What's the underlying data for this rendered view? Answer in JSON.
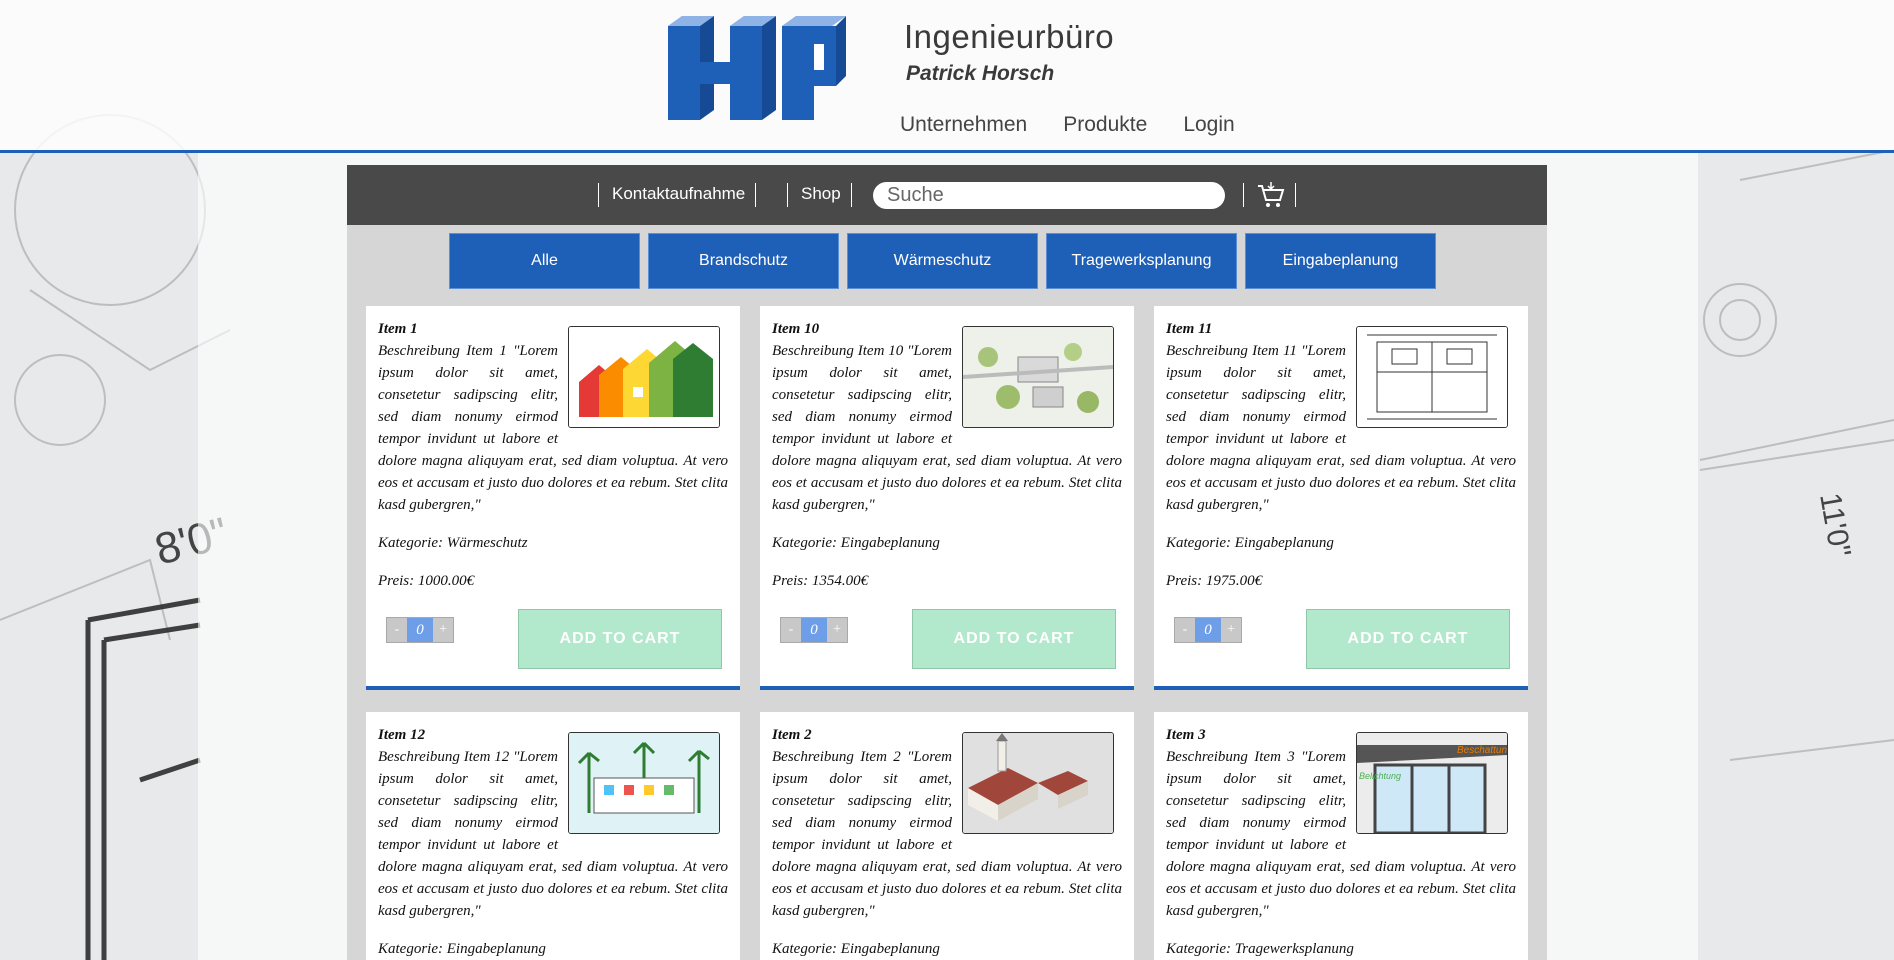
{
  "brand": {
    "title": "Ingenieurbüro",
    "subtitle": "Patrick Horsch",
    "logo_text": "HP"
  },
  "main_nav": [
    "Unternehmen",
    "Produkte",
    "Login"
  ],
  "toolbar": {
    "contact": "Kontaktaufnahme",
    "shop": "Shop",
    "search_placeholder": "Suche",
    "cart_icon": "shopping-cart-icon"
  },
  "filters": [
    "Alle",
    "Brandschutz",
    "Wärmeschutz",
    "Tragewerksplanung",
    "Eingabeplanung"
  ],
  "products": [
    {
      "title": "Item 1",
      "description": "Beschreibung Item 1 \"Lorem ipsum dolor sit amet, consetetur sadipscing elitr, sed diam nonumy eirmod tempor invidunt ut labore et dolore magna aliquyam erat, sed diam voluptua. At vero eos et accusam et justo duo dolores et ea rebum. Stet clita kasd gubergren,\"",
      "category": "Kategorie: Wärmeschutz",
      "price": "Preis: 1000.00€",
      "quantity": "0",
      "add_label": "ADD TO CART",
      "image": "energy-house-image"
    },
    {
      "title": "Item 10",
      "description": "Beschreibung Item 10 \"Lorem ipsum dolor sit amet, consetetur sadipscing elitr, sed diam nonumy eirmod tempor invidunt ut labore et dolore magna aliquyam erat, sed diam voluptua. At vero eos et accusam et justo duo dolores et ea rebum. Stet clita kasd gubergren,\"",
      "category": "Kategorie: Eingabeplanung",
      "price": "Preis: 1354.00€",
      "quantity": "0",
      "add_label": "ADD TO CART",
      "image": "site-plan-image"
    },
    {
      "title": "Item 11",
      "description": "Beschreibung Item 11 \"Lorem ipsum dolor sit amet, consetetur sadipscing elitr, sed diam nonumy eirmod tempor invidunt ut labore et dolore magna aliquyam erat, sed diam voluptua. At vero eos et accusam et justo duo dolores et ea rebum. Stet clita kasd gubergren,\"",
      "category": "Kategorie: Eingabeplanung",
      "price": "Preis: 1975.00€",
      "quantity": "0",
      "add_label": "ADD TO CART",
      "image": "floor-plan-image"
    },
    {
      "title": "Item 12",
      "description": "Beschreibung Item 12 \"Lorem ipsum dolor sit amet, consetetur sadipscing elitr, sed diam nonumy eirmod tempor invidunt ut labore et dolore magna aliquyam erat, sed diam voluptua. At vero eos et accusam et justo duo dolores et ea rebum. Stet clita kasd gubergren,\"",
      "category": "Kategorie: Eingabeplanung",
      "image": "building-sketch-image"
    },
    {
      "title": "Item 2",
      "description": "Beschreibung Item 2 \"Lorem ipsum dolor sit amet, consetetur sadipscing elitr, sed diam nonumy eirmod tempor invidunt ut labore et dolore magna aliquyam erat, sed diam voluptua. At vero eos et accusam et justo duo dolores et ea rebum. Stet clita kasd gubergren,\"",
      "category": "Kategorie: Eingabeplanung",
      "image": "3d-model-image"
    },
    {
      "title": "Item 3",
      "description": "Beschreibung Item 3 \"Lorem ipsum dolor sit amet, consetetur sadipscing elitr, sed diam nonumy eirmod tempor invidunt ut labore et dolore magna aliquyam erat, sed diam voluptua. At vero eos et accusam et justo duo dolores et ea rebum. Stet clita kasd gubergren,\"",
      "category": "Kategorie: Tragewerksplanung",
      "image": "shading-window-image",
      "image_labels": [
        "Beschattung",
        "Belichtung"
      ]
    }
  ],
  "colors": {
    "accent": "#1e5fb8",
    "toolbar": "#4a4949",
    "add_to_cart": "#b2e8cb",
    "panel": "#d6d6d6"
  }
}
